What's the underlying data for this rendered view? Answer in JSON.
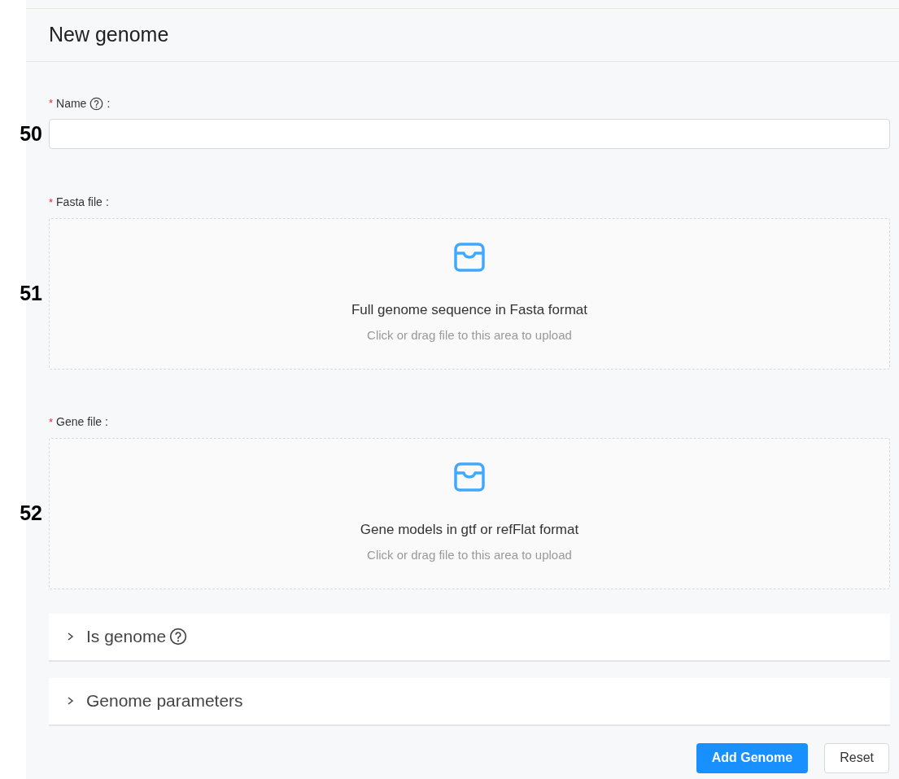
{
  "title": "New genome",
  "fields": [
    {
      "kind": "text",
      "marker": "50",
      "asterisk": "*",
      "label": "Name",
      "help": true,
      "suffix": ":"
    },
    {
      "kind": "upload",
      "marker": "51",
      "asterisk": "*",
      "label": "Fasta file",
      "help": false,
      "suffix": ":",
      "text": "Full genome sequence in Fasta format",
      "hint": "Click or drag file to this area to upload"
    },
    {
      "kind": "upload",
      "marker": "52",
      "asterisk": "*",
      "label": "Gene file",
      "help": false,
      "suffix": ":",
      "text": "Gene models in gtf or refFlat format",
      "hint": "Click or drag file to this area to upload"
    }
  ],
  "panels": [
    {
      "label": "Is genome",
      "help": true,
      "expanded": false
    },
    {
      "label": "Genome parameters",
      "help": false,
      "expanded": false
    }
  ],
  "buttons": [
    {
      "label": "Add Genome",
      "kind": "primary"
    },
    {
      "label": "Reset",
      "kind": "default"
    }
  ]
}
